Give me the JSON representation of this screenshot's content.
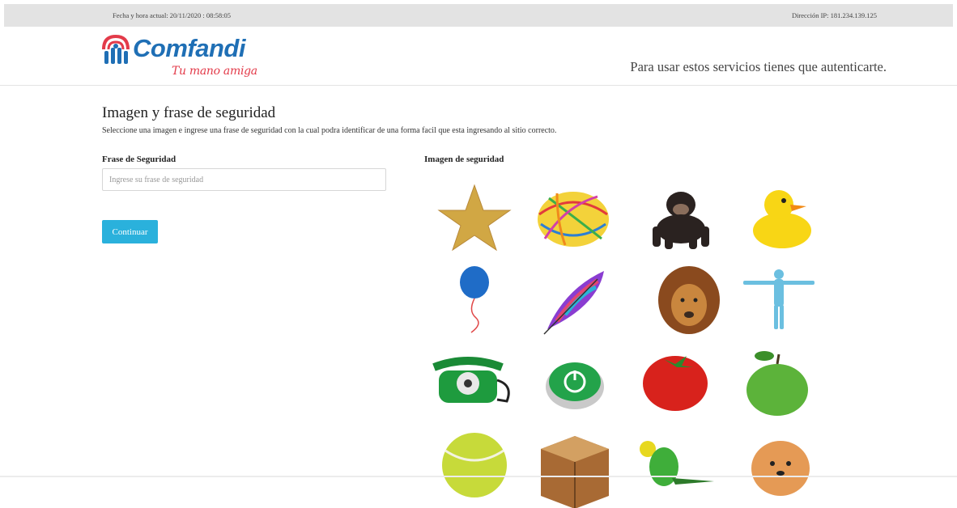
{
  "topbar": {
    "datetime": "Fecha y hora actual: 20/11/2020 : 08:58:05",
    "ip": "Dirección IP: 181.234.139.125"
  },
  "header": {
    "brand": "Comfandi",
    "slogan": "Tu mano amiga",
    "auth_message": "Para usar estos servicios tienes que autenticarte."
  },
  "form": {
    "title": "Imagen y frase de seguridad",
    "subtitle": "Seleccione una imagen e ingrese una frase de seguridad con la cual podra identificar de una forma facil que esta ingresando al sitio correcto.",
    "phrase_label": "Frase de Seguridad",
    "phrase_placeholder": "Ingrese su frase de seguridad",
    "phrase_value": "",
    "continue_label": "Continuar",
    "image_label": "Imagen de seguridad"
  },
  "images": [
    "star-image",
    "yarn-ball-image",
    "monkey-image",
    "duck-image",
    "balloon-image",
    "feather-image",
    "lion-image",
    "human-figure-image",
    "telephone-image",
    "power-button-image",
    "tomato-image",
    "apple-image",
    "tennis-ball-image",
    "wood-cube-image",
    "parakeet-image",
    "dog-image"
  ],
  "colors": {
    "brand_blue": "#1f6fb5",
    "slogan_red": "#e33b4a",
    "button": "#2ab1dc",
    "topbar": "#e3e3e3"
  }
}
